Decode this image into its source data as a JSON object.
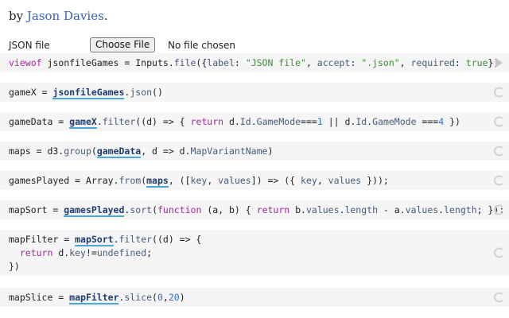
{
  "byline": {
    "prefix": "by ",
    "author": "Jason Davies",
    "suffix": "."
  },
  "file_input": {
    "label": "JSON file",
    "button_label": "Choose File",
    "status": "No file chosen"
  },
  "cells": [
    {
      "name": "cell-viewof-jsonfilegames",
      "tokens": [
        {
          "t": "viewof",
          "c": "kw"
        },
        {
          "t": " jsonfileGames = Inputs.",
          "c": ""
        },
        {
          "t": "file",
          "c": "prop"
        },
        {
          "t": "({",
          "c": ""
        },
        {
          "t": "label",
          "c": "prop"
        },
        {
          "t": ": ",
          "c": ""
        },
        {
          "t": "\"JSON file\"",
          "c": "str"
        },
        {
          "t": ", ",
          "c": ""
        },
        {
          "t": "accept",
          "c": "prop"
        },
        {
          "t": ": ",
          "c": ""
        },
        {
          "t": "\".json\"",
          "c": "str"
        },
        {
          "t": ", ",
          "c": ""
        },
        {
          "t": "required",
          "c": "prop"
        },
        {
          "t": ": ",
          "c": ""
        },
        {
          "t": "true",
          "c": "str"
        },
        {
          "t": "})",
          "c": ""
        }
      ],
      "icon": "play-icon"
    },
    {
      "name": "cell-gamex",
      "tokens": [
        {
          "t": "gameX = ",
          "c": ""
        },
        {
          "t": "jsonfileGames",
          "c": "ref"
        },
        {
          "t": ".",
          "c": ""
        },
        {
          "t": "json",
          "c": "prop"
        },
        {
          "t": "()",
          "c": ""
        }
      ],
      "icon": "refresh-icon"
    },
    {
      "name": "cell-gamedata",
      "tokens": [
        {
          "t": "gameData = ",
          "c": ""
        },
        {
          "t": "gameX",
          "c": "ref"
        },
        {
          "t": ".",
          "c": ""
        },
        {
          "t": "filter",
          "c": "prop"
        },
        {
          "t": "((d) => { ",
          "c": ""
        },
        {
          "t": "return",
          "c": "kw"
        },
        {
          "t": " d.",
          "c": ""
        },
        {
          "t": "Id",
          "c": "prop"
        },
        {
          "t": ".",
          "c": ""
        },
        {
          "t": "GameMode",
          "c": "prop"
        },
        {
          "t": "===",
          "c": ""
        },
        {
          "t": "1",
          "c": "num"
        },
        {
          "t": " || d.",
          "c": ""
        },
        {
          "t": "Id",
          "c": "prop"
        },
        {
          "t": ".",
          "c": ""
        },
        {
          "t": "GameMode",
          "c": "prop"
        },
        {
          "t": " ===",
          "c": ""
        },
        {
          "t": "4",
          "c": "num"
        },
        {
          "t": " })",
          "c": ""
        }
      ],
      "icon": "refresh-icon"
    },
    {
      "name": "cell-maps",
      "tokens": [
        {
          "t": "maps = d3.",
          "c": ""
        },
        {
          "t": "group",
          "c": "prop"
        },
        {
          "t": "(",
          "c": ""
        },
        {
          "t": "gameData",
          "c": "ref"
        },
        {
          "t": ", d => d.",
          "c": ""
        },
        {
          "t": "MapVariantName",
          "c": "prop"
        },
        {
          "t": ")",
          "c": ""
        }
      ],
      "icon": "refresh-icon"
    },
    {
      "name": "cell-gamesplayed",
      "tokens": [
        {
          "t": "gamesPlayed = Array.",
          "c": ""
        },
        {
          "t": "from",
          "c": "prop"
        },
        {
          "t": "(",
          "c": ""
        },
        {
          "t": "maps",
          "c": "ref"
        },
        {
          "t": ", ([",
          "c": ""
        },
        {
          "t": "key",
          "c": "prop"
        },
        {
          "t": ", ",
          "c": ""
        },
        {
          "t": "values",
          "c": "prop"
        },
        {
          "t": "]) => ({ ",
          "c": ""
        },
        {
          "t": "key",
          "c": "prop"
        },
        {
          "t": ", ",
          "c": ""
        },
        {
          "t": "values",
          "c": "prop"
        },
        {
          "t": " }));",
          "c": ""
        }
      ],
      "icon": "refresh-icon"
    },
    {
      "name": "cell-mapsort",
      "tokens": [
        {
          "t": "mapSort = ",
          "c": ""
        },
        {
          "t": "gamesPlayed",
          "c": "ref"
        },
        {
          "t": ".",
          "c": ""
        },
        {
          "t": "sort",
          "c": "prop"
        },
        {
          "t": "(",
          "c": ""
        },
        {
          "t": "function",
          "c": "kw"
        },
        {
          "t": " (a, b) { ",
          "c": ""
        },
        {
          "t": "return",
          "c": "kw"
        },
        {
          "t": " b.",
          "c": ""
        },
        {
          "t": "values",
          "c": "prop"
        },
        {
          "t": ".",
          "c": ""
        },
        {
          "t": "length",
          "c": "prop"
        },
        {
          "t": " - a.",
          "c": ""
        },
        {
          "t": "values",
          "c": "prop"
        },
        {
          "t": ".",
          "c": ""
        },
        {
          "t": "length",
          "c": "prop"
        },
        {
          "t": "; });",
          "c": ""
        }
      ],
      "icon": "refresh-icon"
    },
    {
      "name": "cell-mapfilter",
      "lines": [
        [
          {
            "t": "mapFilter = ",
            "c": ""
          },
          {
            "t": "mapSort",
            "c": "ref"
          },
          {
            "t": ".",
            "c": ""
          },
          {
            "t": "filter",
            "c": "prop"
          },
          {
            "t": "((d) => {",
            "c": ""
          }
        ],
        [
          {
            "t": "  ",
            "c": ""
          },
          {
            "t": "return",
            "c": "kw"
          },
          {
            "t": " d.",
            "c": ""
          },
          {
            "t": "key",
            "c": "prop"
          },
          {
            "t": "!=",
            "c": ""
          },
          {
            "t": "undefined",
            "c": "prop"
          },
          {
            "t": ";",
            "c": ""
          }
        ],
        [
          {
            "t": "})",
            "c": ""
          }
        ]
      ],
      "icon": "refresh-icon"
    },
    {
      "name": "cell-mapslice",
      "tokens": [
        {
          "t": "mapSlice = ",
          "c": ""
        },
        {
          "t": "mapFilter",
          "c": "ref"
        },
        {
          "t": ".",
          "c": ""
        },
        {
          "t": "slice",
          "c": "prop"
        },
        {
          "t": "(",
          "c": ""
        },
        {
          "t": "0",
          "c": "num"
        },
        {
          "t": ",",
          "c": ""
        },
        {
          "t": "20",
          "c": "num"
        },
        {
          "t": ")",
          "c": ""
        }
      ],
      "icon": "refresh-icon"
    }
  ]
}
